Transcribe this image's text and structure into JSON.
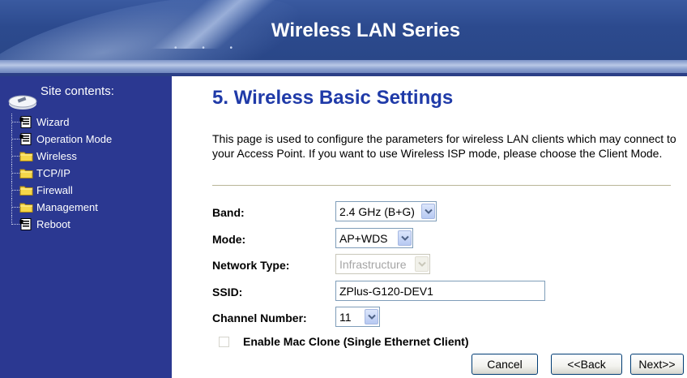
{
  "header": {
    "title": "Wireless LAN Series"
  },
  "sidebar": {
    "title": "Site contents:",
    "items": [
      {
        "label": "Wizard",
        "icon": "page-icon"
      },
      {
        "label": "Operation Mode",
        "icon": "page-icon"
      },
      {
        "label": "Wireless",
        "icon": "folder-icon"
      },
      {
        "label": "TCP/IP",
        "icon": "folder-icon"
      },
      {
        "label": "Firewall",
        "icon": "folder-icon"
      },
      {
        "label": "Management",
        "icon": "folder-icon"
      },
      {
        "label": "Reboot",
        "icon": "page-icon"
      }
    ]
  },
  "main": {
    "title": "5. Wireless Basic Settings",
    "description": "This page is used to configure the parameters for wireless LAN clients which may connect to your Access Point. If you want to use Wireless ISP mode, please choose the Client Mode.",
    "form": {
      "band": {
        "label": "Band:",
        "value": "2.4 GHz (B+G)"
      },
      "mode": {
        "label": "Mode:",
        "value": "AP+WDS"
      },
      "network_type": {
        "label": "Network Type:",
        "value": "Infrastructure"
      },
      "ssid": {
        "label": "SSID:",
        "value": "ZPlus-G120-DEV1"
      },
      "channel": {
        "label": "Channel Number:",
        "value": "11"
      },
      "mac_clone": {
        "label": "Enable Mac Clone (Single Ethernet Client)",
        "checked": false
      }
    },
    "buttons": {
      "cancel": "Cancel",
      "back": "<<Back",
      "next": "Next>>"
    }
  },
  "colors": {
    "header_bg": "#2c4a8e",
    "sidebar_bg": "#2b3891",
    "title_blue": "#1f3aa8"
  }
}
